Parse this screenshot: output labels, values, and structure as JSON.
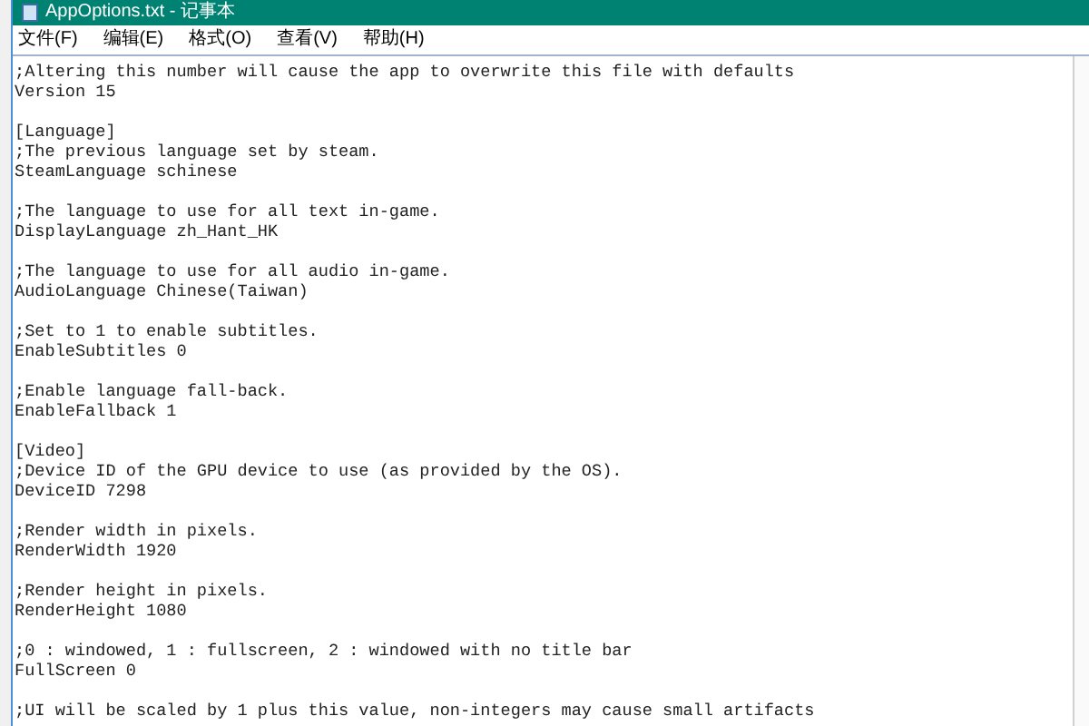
{
  "window": {
    "title": "AppOptions.txt - 记事本"
  },
  "menu": [
    "文件(F)",
    "编辑(E)",
    "格式(O)",
    "查看(V)",
    "帮助(H)"
  ],
  "lines": [
    {
      "kind": "text",
      "text": ";Altering this number will cause the app to overwrite this file with defaults"
    },
    {
      "kind": "text",
      "text": "Version 15"
    },
    {
      "kind": "blank"
    },
    {
      "kind": "text",
      "text": "[Language]"
    },
    {
      "kind": "text",
      "text": ";The previous language set by steam."
    },
    {
      "kind": "text",
      "text": "SteamLanguage schinese"
    },
    {
      "kind": "blank"
    },
    {
      "kind": "text",
      "text": ";The language to use for all text in-game."
    },
    {
      "kind": "text",
      "text": "DisplayLanguage zh_Hant_HK"
    },
    {
      "kind": "blank"
    },
    {
      "kind": "text",
      "text": ";The language to use for all audio in-game."
    },
    {
      "kind": "text",
      "text": "AudioLanguage Chinese(Taiwan)"
    },
    {
      "kind": "blank"
    },
    {
      "kind": "text",
      "text": ";Set to 1 to enable subtitles."
    },
    {
      "kind": "text",
      "text": "EnableSubtitles 0"
    },
    {
      "kind": "blank"
    },
    {
      "kind": "text",
      "text": ";Enable language fall-back."
    },
    {
      "kind": "text",
      "text": "EnableFallback 1"
    },
    {
      "kind": "blank"
    },
    {
      "kind": "text",
      "text": "[Video]"
    },
    {
      "kind": "text",
      "text": ";Device ID of the GPU device to use (as provided by the OS)."
    },
    {
      "kind": "text",
      "text": "DeviceID 7298"
    },
    {
      "kind": "blank"
    },
    {
      "kind": "text",
      "text": ";Render width in pixels."
    },
    {
      "kind": "text",
      "text": "RenderWidth 1920"
    },
    {
      "kind": "blank"
    },
    {
      "kind": "text",
      "text": ";Render height in pixels."
    },
    {
      "kind": "text",
      "text": "RenderHeight 1080"
    },
    {
      "kind": "blank"
    },
    {
      "kind": "text",
      "text": ";0 : windowed, 1 : fullscreen, 2 : windowed with no title bar"
    },
    {
      "kind": "text",
      "text": "FullScreen 0"
    },
    {
      "kind": "blank"
    },
    {
      "kind": "text",
      "text": ";UI will be scaled by 1 plus this value, non-integers may cause small artifacts"
    }
  ]
}
